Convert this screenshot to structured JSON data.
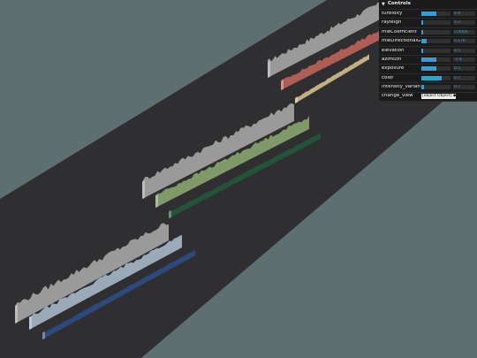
{
  "gui": {
    "title": "Controls",
    "controls": [
      {
        "label": "turbidity",
        "value": "6.9",
        "level": 0.52
      },
      {
        "label": "rayleigh",
        "value": "0.2",
        "level": 0.05
      },
      {
        "label": "mieCoefficient",
        "value": "0.0006",
        "level": 0.03
      },
      {
        "label": "mieDirectionalG",
        "value": "0.176",
        "level": 0.18
      },
      {
        "label": "elevation",
        "value": "0.5",
        "level": 0.02
      },
      {
        "label": "azimuth",
        "value": "-1.4",
        "level": 0.5
      },
      {
        "label": "exposure",
        "value": "0.5",
        "level": 0.5
      },
      {
        "label": "color",
        "value": "0.7",
        "level": 0.7
      },
      {
        "label": "intensity_variance_on_time",
        "value": "0.7",
        "level": 0.1
      }
    ],
    "change_view": {
      "label": "change_view",
      "value": "[object Object]"
    }
  },
  "scene": {
    "background_color": "#5e6f72",
    "road_color": "#2f2f31",
    "groups": [
      {
        "name": "top",
        "colors": [
          "#9a9a9a",
          "#b05e55",
          "#c4ae83"
        ]
      },
      {
        "name": "middle",
        "colors": [
          "#9a9a9a",
          "#7f9a68",
          "#23543a"
        ]
      },
      {
        "name": "bottom",
        "colors": [
          "#9a9a9a",
          "#9aaab8",
          "#2d4a7e"
        ]
      }
    ]
  }
}
